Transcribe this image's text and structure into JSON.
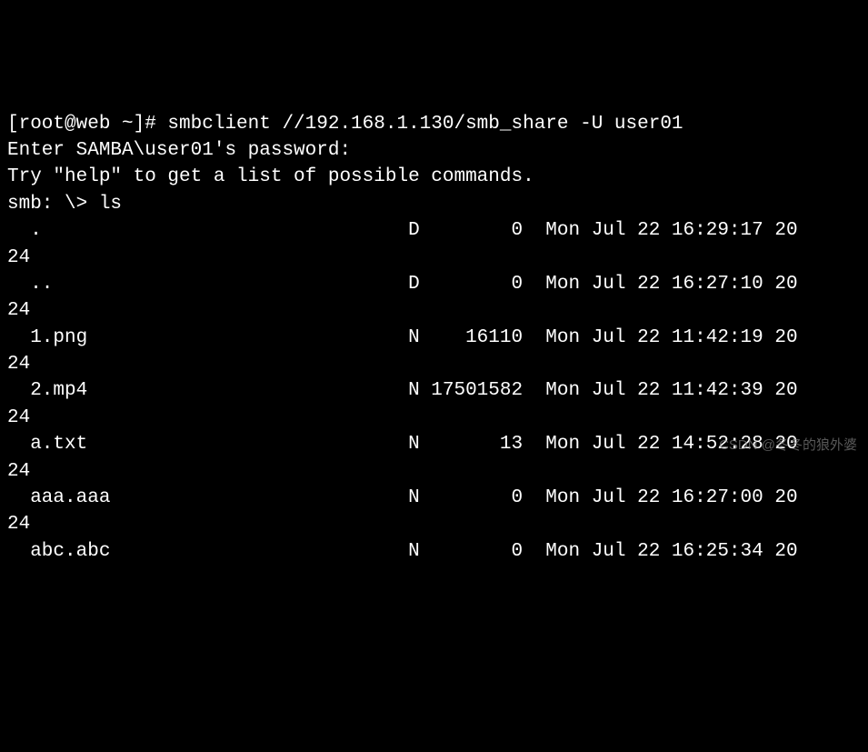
{
  "prompt": {
    "user": "root",
    "host": "web",
    "dir": "~",
    "symbol": "#",
    "command": "smbclient //192.168.1.130/smb_share -U user01"
  },
  "enter_password": "Enter SAMBA\\user01's password:",
  "help_line": "Try \"help\" to get a list of possible commands.",
  "smb_prompt": "smb: \\> ",
  "smb_command": "ls",
  "files": [
    {
      "name": ".",
      "type": "D",
      "size": "0",
      "date": "Mon Jul 22 16:29:17 20",
      "wrap": "24"
    },
    {
      "name": "..",
      "type": "D",
      "size": "0",
      "date": "Mon Jul 22 16:27:10 20",
      "wrap": "24"
    },
    {
      "name": "1.png",
      "type": "N",
      "size": "16110",
      "date": "Mon Jul 22 11:42:19 20",
      "wrap": "24"
    },
    {
      "name": "2.mp4",
      "type": "N",
      "size": "17501582",
      "date": "Mon Jul 22 11:42:39 20",
      "wrap": "24"
    },
    {
      "name": "a.txt",
      "type": "N",
      "size": "13",
      "date": "Mon Jul 22 14:52:28 20",
      "wrap": "24"
    },
    {
      "name": "aaa.aaa",
      "type": "N",
      "size": "0",
      "date": "Mon Jul 22 16:27:00 20",
      "wrap": "24"
    },
    {
      "name": "abc.abc",
      "type": "N",
      "size": "0",
      "date": "Mon Jul 22 16:25:34 20",
      "wrap": ""
    }
  ],
  "watermark": "CSDN @冬冬的狼外婆"
}
